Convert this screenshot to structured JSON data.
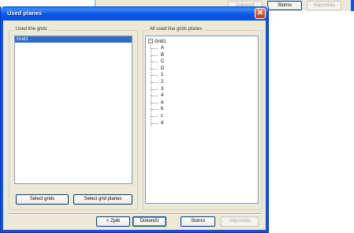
{
  "background_window": {
    "buttons": [
      "Dokončit",
      "Storno",
      "Nápověda"
    ]
  },
  "dialog": {
    "title": "Used planes",
    "left_group": {
      "legend": "Used line grids",
      "items": [
        "Grid1"
      ],
      "selected": "Grid1"
    },
    "right_group": {
      "legend": "All used line grids planes",
      "root": "Grid1",
      "children": [
        "A",
        "B",
        "C",
        "D",
        "1",
        "2",
        "3",
        "4",
        "a",
        "b",
        "c",
        "d"
      ]
    },
    "buttons": {
      "select_grids": "Select grids",
      "select_grid_planes": "Select grid planes",
      "back": "< Zpět",
      "finish": "Dokončit",
      "cancel": "Storno",
      "help": "Nápověda"
    }
  },
  "colors": {
    "titlebar": "#0a5fef",
    "selection": "#316ac5",
    "dialog_bg": "#ece9d8",
    "close": "#c23b1a"
  }
}
